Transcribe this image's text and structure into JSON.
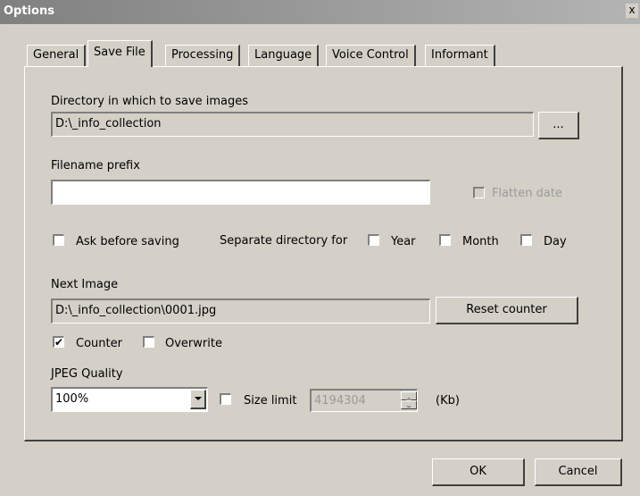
{
  "window": {
    "title": "Options",
    "close_glyph": "x"
  },
  "tabs": [
    {
      "label": "General",
      "active": false
    },
    {
      "label": "Save File",
      "active": true
    },
    {
      "label": "Processing",
      "active": false
    },
    {
      "label": "Language",
      "active": false
    },
    {
      "label": "Voice Control",
      "active": false
    },
    {
      "label": "Informant",
      "active": false
    }
  ],
  "save_file": {
    "directory_label": "Directory in which to save images",
    "directory_value": "D:\\_info_collection",
    "browse_label": "...",
    "prefix_label": "Filename prefix",
    "prefix_value": "",
    "flatten_date_label": "Flatten date",
    "flatten_date_checked": false,
    "ask_before_saving_label": "Ask before saving",
    "ask_before_saving_checked": false,
    "separate_dir_label": "Separate directory for",
    "year_label": "Year",
    "year_checked": false,
    "month_label": "Month",
    "month_checked": false,
    "day_label": "Day",
    "day_checked": false,
    "next_image_label": "Next Image",
    "next_image_value": "D:\\_info_collection\\0001.jpg",
    "reset_counter_label": "Reset counter",
    "counter_label": "Counter",
    "counter_checked": true,
    "overwrite_label": "Overwrite",
    "overwrite_checked": false,
    "jpeg_quality_label": "JPEG Quality",
    "jpeg_quality_value": "100%",
    "size_limit_label": "Size limit",
    "size_limit_checked": false,
    "size_limit_value": "4194304",
    "size_unit": "(Kb)",
    "check_glyph": "✔"
  },
  "footer": {
    "ok_label": "OK",
    "cancel_label": "Cancel"
  },
  "icons": {
    "combo_arrow": "chevron-down-icon",
    "spin_up": "spin-up-icon",
    "spin_down": "spin-down-icon"
  }
}
